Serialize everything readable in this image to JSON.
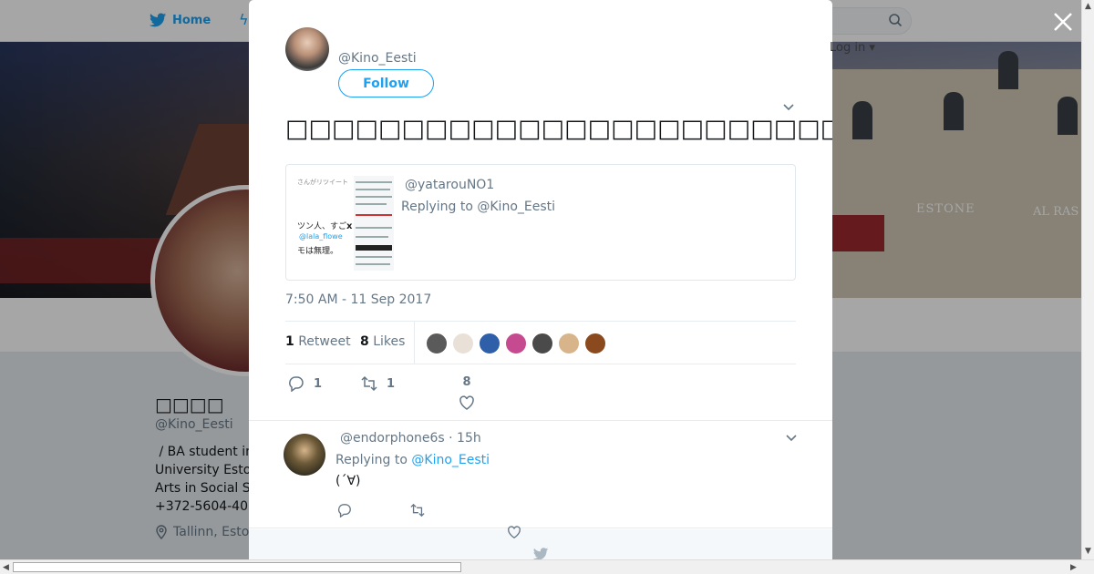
{
  "nav": {
    "home_label": "Home",
    "login_label": "Log in ▾"
  },
  "background_profile": {
    "banner_sign_left": "ESTONE",
    "banner_sign_right": "AL RAS",
    "name": "□□□□",
    "handle": "@Kino_Eesti",
    "bio": " / BA student in\nUniversity Esto\nArts in Social S\n+372-5604-40",
    "location": "Tallinn, Esto"
  },
  "tweet": {
    "author_handle": "@Kino_Eesti",
    "follow_label": "Follow",
    "text": "□□□□□□□□□□□□□□□□□□□□□□□□□□□□□□□□□□□□□□□□□□□□□",
    "quote": {
      "handle": "@yatarouNO1",
      "replying_to": "Replying to @Kino_Eesti",
      "thumb_lines": [
        "さんがリツイート",
        "ツン人、すご",
        "@lala_flowe",
        "モは無理。",
        "x"
      ]
    },
    "timestamp": "7:50 AM - 11 Sep 2017",
    "retweets_count": "1",
    "retweets_label": "Retweet",
    "likes_count": "8",
    "likes_label": "Likes",
    "liker_colors": [
      "#5a5a5a",
      "#e9e1d8",
      "#2f5fa8",
      "#c54a8f",
      "#4a4a4a",
      "#d8b48a",
      "#8a4a1e"
    ],
    "action_reply_count": "1",
    "action_retweet_count": "1",
    "action_like_count": "8"
  },
  "reply": {
    "header": "@endorphone6s · 15h",
    "replying_prefix": "Replying to ",
    "replying_handle": "@Kino_Eesti",
    "text": "(´∀)"
  },
  "colors": {
    "accent": "#1da1f2",
    "muted": "#657786",
    "text": "#14171a"
  }
}
